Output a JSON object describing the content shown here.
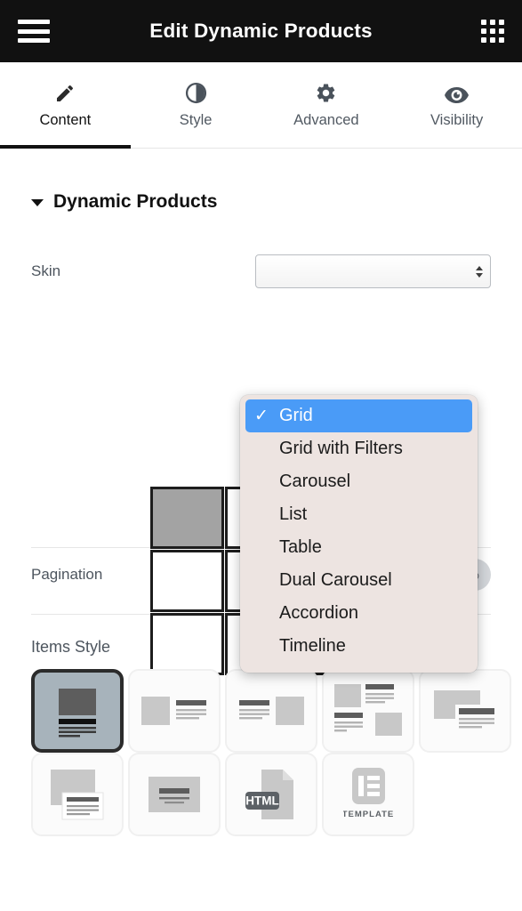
{
  "topbar": {
    "menu_icon": "hamburger-menu-icon",
    "title": "Edit Dynamic Products",
    "apps_icon": "apps-grid-icon"
  },
  "tabs": [
    {
      "label": "Content",
      "icon": "pencil-icon",
      "active": true
    },
    {
      "label": "Style",
      "icon": "contrast-icon",
      "active": false
    },
    {
      "label": "Advanced",
      "icon": "gear-icon",
      "active": false
    },
    {
      "label": "Visibility",
      "icon": "eye-icon",
      "active": false
    }
  ],
  "section": {
    "title": "Dynamic Products",
    "caret_icon": "caret-down-icon",
    "expanded": true
  },
  "skin": {
    "label": "Skin",
    "selected": "Grid",
    "select_arrows_icon": "select-stepper-icon",
    "options": [
      "Grid",
      "Grid with Filters",
      "Carousel",
      "List",
      "Table",
      "Dual Carousel",
      "Accordion",
      "Timeline"
    ],
    "checkmark": "✓"
  },
  "pagination": {
    "label": "Pagination",
    "value": "No",
    "enabled": false
  },
  "items_style": {
    "label": "Items Style",
    "selected_index": 0,
    "thumbs": [
      {
        "name": "thumb-image-top",
        "icon": "layout-image-top-icon"
      },
      {
        "name": "thumb-image-left",
        "icon": "layout-image-left-icon"
      },
      {
        "name": "thumb-image-right",
        "icon": "layout-image-right-icon"
      },
      {
        "name": "thumb-zigzag",
        "icon": "layout-zigzag-icon"
      },
      {
        "name": "thumb-overlap",
        "icon": "layout-overlap-icon"
      },
      {
        "name": "thumb-card-offset",
        "icon": "layout-card-offset-icon"
      },
      {
        "name": "thumb-centered-text",
        "icon": "layout-centered-text-icon"
      },
      {
        "name": "thumb-html",
        "icon": "html-file-icon",
        "caption": "HTML"
      },
      {
        "name": "thumb-template",
        "icon": "elementor-template-icon",
        "caption": "TEMPLATE"
      }
    ]
  },
  "colors": {
    "topbar_bg": "#111111",
    "accent_blue": "#4a9bf7",
    "dropdown_bg": "#ede4e1",
    "muted_text": "#4d555e",
    "thumb_selected_bg": "#a7b3bb"
  }
}
